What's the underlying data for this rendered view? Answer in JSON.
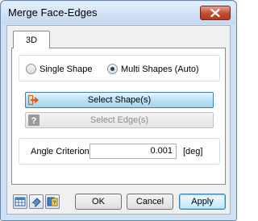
{
  "window": {
    "title": "Merge Face-Edges"
  },
  "tabs": [
    {
      "label": "3D"
    }
  ],
  "mode": {
    "options": [
      {
        "label": "Single Shape",
        "checked": false
      },
      {
        "label": "Multi Shapes (Auto)",
        "checked": true
      }
    ]
  },
  "selection": {
    "select_shapes_label": "Select Shape(s)",
    "select_edges_label": "Select Edge(s)",
    "select_shapes_icon": "arrow-select-icon",
    "select_edges_icon": "question-icon"
  },
  "angle": {
    "label": "Angle Criterion",
    "value": "0.001",
    "unit": "[deg]"
  },
  "footer": {
    "ok_label": "OK",
    "cancel_label": "Cancel",
    "apply_label": "Apply",
    "tool_icons": [
      "table-icon",
      "eraser-icon",
      "help-book-icon"
    ]
  },
  "colors": {
    "window_frame": "#cfe0f3",
    "close_button": "#c24a30",
    "active_button": "#bde0f6",
    "disabled_text": "#8a8a8a"
  }
}
